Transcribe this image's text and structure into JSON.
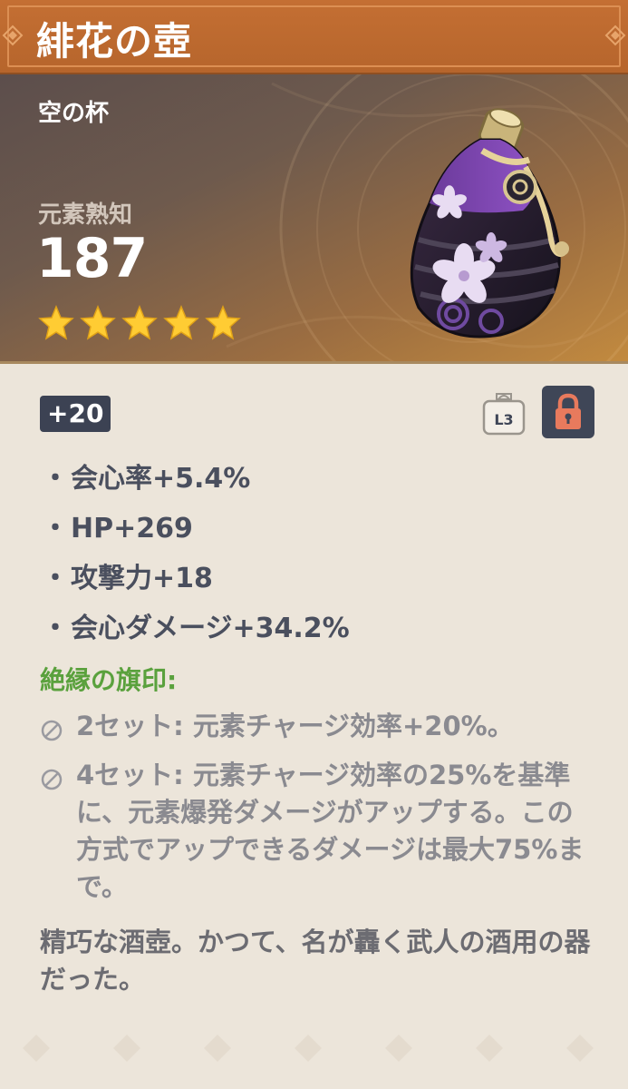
{
  "artifact": {
    "name": "緋花の壺",
    "slot": "空の杯",
    "main_stat": {
      "label": "元素熟知",
      "value": "187"
    },
    "rarity": 5,
    "level": "+20",
    "lock_level_label": "L3",
    "substats": [
      {
        "bullet": "・",
        "text": "会心率+5.4%"
      },
      {
        "bullet": "・",
        "text": "HP+269"
      },
      {
        "bullet": "・",
        "text": "攻撃力+18"
      },
      {
        "bullet": "・",
        "text": "会心ダメージ+34.2%"
      }
    ],
    "set": {
      "name": "絶縁の旗印:",
      "effects": [
        {
          "text": "2セット: 元素チャージ効率+20%。"
        },
        {
          "text": "4セット: 元素チャージ効率の25%を基準に、元素爆発ダメージがアップする。この方式でアップできるダメージは最大75%まで。"
        }
      ]
    },
    "description": "精巧な酒壺。かつて、名が轟く武人の酒用の器だった。"
  },
  "colors": {
    "title_bar": "#b96a2f",
    "star": "#ffcc33",
    "set_name": "#5aa13d",
    "lock": "#e87a5d"
  },
  "icons": {
    "star": "star-icon",
    "lock": "lock-icon",
    "lock_level": "lock-level-icon",
    "inactive_set": "disabled-circle-icon"
  }
}
